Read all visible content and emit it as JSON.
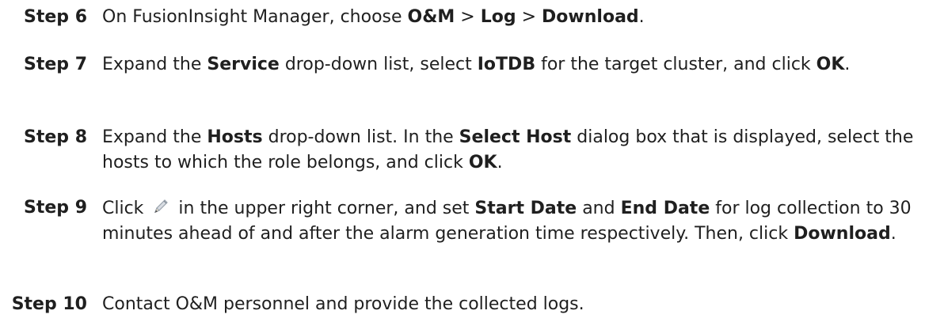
{
  "steps": [
    {
      "label": "Step 6",
      "parts": [
        {
          "t": "On FusionInsight Manager, choose "
        },
        {
          "b": "O&M"
        },
        {
          "t": " > "
        },
        {
          "b": "Log"
        },
        {
          "t": " > "
        },
        {
          "b": "Download"
        },
        {
          "t": "."
        }
      ]
    },
    {
      "label": "Step 7",
      "parts": [
        {
          "t": "Expand the "
        },
        {
          "b": "Service"
        },
        {
          "t": " drop-down list, select "
        },
        {
          "b": "IoTDB"
        },
        {
          "t": " for the target cluster, and click "
        },
        {
          "b": "OK"
        },
        {
          "t": "."
        }
      ]
    },
    {
      "label": "Step 8",
      "parts": [
        {
          "t": "Expand the "
        },
        {
          "b": "Hosts"
        },
        {
          "t": " drop-down list. In the "
        },
        {
          "b": "Select Host"
        },
        {
          "t": " dialog box that is displayed, select the hosts to which the role belongs, and click "
        },
        {
          "b": "OK"
        },
        {
          "t": "."
        }
      ]
    },
    {
      "label": "Step 9",
      "parts": [
        {
          "t": "Click "
        },
        {
          "icon": "pencil-icon"
        },
        {
          "t": " in the upper right corner, and set "
        },
        {
          "b": "Start Date"
        },
        {
          "t": " and "
        },
        {
          "b": "End Date"
        },
        {
          "t": " for log collection to 30 minutes ahead of and after the alarm generation time respectively. Then, click "
        },
        {
          "b": "Download"
        },
        {
          "t": "."
        }
      ]
    },
    {
      "label": "Step 10",
      "parts": [
        {
          "t": "Contact O&M personnel and provide the collected logs."
        }
      ]
    }
  ]
}
